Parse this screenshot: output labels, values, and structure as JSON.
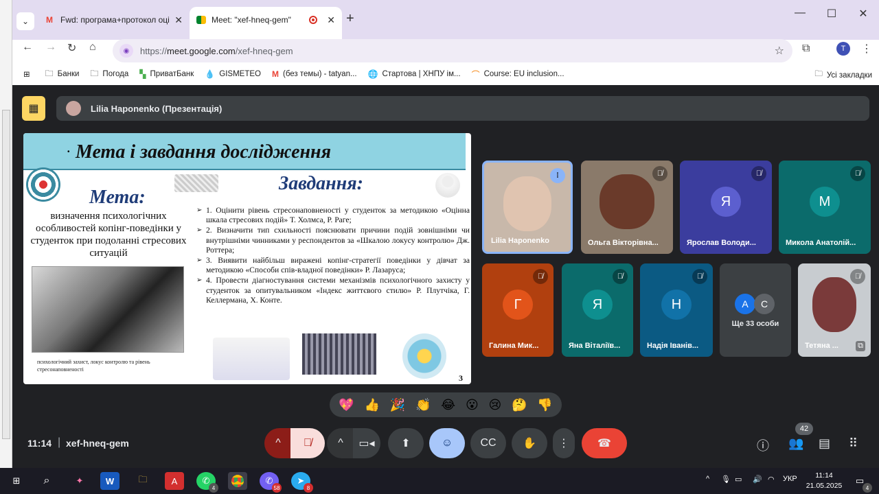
{
  "browser": {
    "tabs": [
      {
        "label": "Fwd: програма+протокол оці",
        "icon": "gmail-icon",
        "active": false
      },
      {
        "label": "Meet: \"xef-hneq-gem\"",
        "icon": "meet-icon",
        "active": true
      }
    ],
    "url_prefix": "https://",
    "url_main": "meet.google.com",
    "url_path": "/xef-hneq-gem",
    "profile_initial": "T",
    "bookmarks": [
      {
        "label": "Банки",
        "icon": "folder-icon"
      },
      {
        "label": "Погода",
        "icon": "folder-icon"
      },
      {
        "label": "ПриватБанк",
        "icon": "privatbank-icon"
      },
      {
        "label": "GISMETEO",
        "icon": "gismeteo-icon"
      },
      {
        "label": "(без темы) - tatyan...",
        "icon": "gmail-icon"
      },
      {
        "label": "Стартова | ХНПУ ім...",
        "icon": "university-icon"
      },
      {
        "label": "Course: EU inclusion...",
        "icon": "course-icon"
      }
    ],
    "all_bookmarks": "Усі закладки"
  },
  "meet": {
    "presenter_label": "Lilia Haponenko (Презентація)",
    "slide": {
      "title": "Мета і завдання дослідження",
      "meta_heading": "Мета:",
      "meta_text": "визначення психологічних особливостей копінг-поведінки у студенток при подоланні стресових ситуацій",
      "tasks_heading": "Завдання:",
      "tasks": [
        "1.  Оцінити рівень стресонаповненості у студенток за методикою «Оцінна шкала стресових подій» Т. Холмса, Р. Раге;",
        "2.  Визначити тип схильності пояснювати причини подій зовнішніми чи внутрішніми чинниками у респондентов за «Шкалою локусу контролю» Дж. Роттера;",
        "3.  Виявити найбільш виражені копінг-стратегії поведінки у дівчат за методикою «Способи спів-владної поведінки» Р. Лазаруса;",
        "4.  Провести діагностування системи механізмів психологічного захисту у студенток за опитувальником «Індекс життєвого стилю» Р. Плутчіка, Г. Келлермана, Х. Конте."
      ],
      "photo_caption": "психологічний захист, локус контролю та рівень стресонаповненості",
      "page_number": "3"
    },
    "participants": [
      {
        "name": "Lilia Haponenko",
        "type": "video",
        "speaking": true
      },
      {
        "name": "Ольга Вікторівна...",
        "type": "video",
        "muted": true
      },
      {
        "name": "Ярослав Володи...",
        "initial": "Я",
        "bg": "#3b3d9e",
        "avatar": "#5c5fcf",
        "muted": true
      },
      {
        "name": "Микола Анатолій...",
        "initial": "М",
        "bg": "#0b6b6b",
        "avatar": "#0e8f8f",
        "muted": true
      },
      {
        "name": "Галина Мик...",
        "initial": "Г",
        "bg": "#b1400f",
        "avatar": "#e2541a",
        "muted": true
      },
      {
        "name": "Яна Віталіїв...",
        "initial": "Я",
        "bg": "#0b6b6b",
        "avatar": "#0e8f8f",
        "muted": true
      },
      {
        "name": "Надія Іванів...",
        "initial": "Н",
        "bg": "#0b5a83",
        "avatar": "#1172a8",
        "muted": true
      },
      {
        "name": "Тетяна ...",
        "type": "video",
        "muted": true
      }
    ],
    "more": {
      "label": "Ще 33 особи",
      "initials": [
        "A",
        "C"
      ]
    },
    "reactions": [
      "💖",
      "👍",
      "🎉",
      "👏",
      "😂",
      "😮",
      "😢",
      "🤔",
      "👎"
    ],
    "time": "11:14",
    "meeting_code": "xef-hneq-gem",
    "people_count": "42"
  },
  "taskbar": {
    "clock_time": "11:14",
    "clock_date": "21.05.2025",
    "lang": "УКР",
    "whatsapp_count": "4",
    "viber_count": "58",
    "telegram_count": "8",
    "notif_count": "4"
  },
  "colors": {
    "end_call": "#ea4335",
    "mic_muted_bg": "#f9dedc",
    "mic_muted_fg": "#b3261e",
    "accent_blue": "#a8c7fa"
  }
}
